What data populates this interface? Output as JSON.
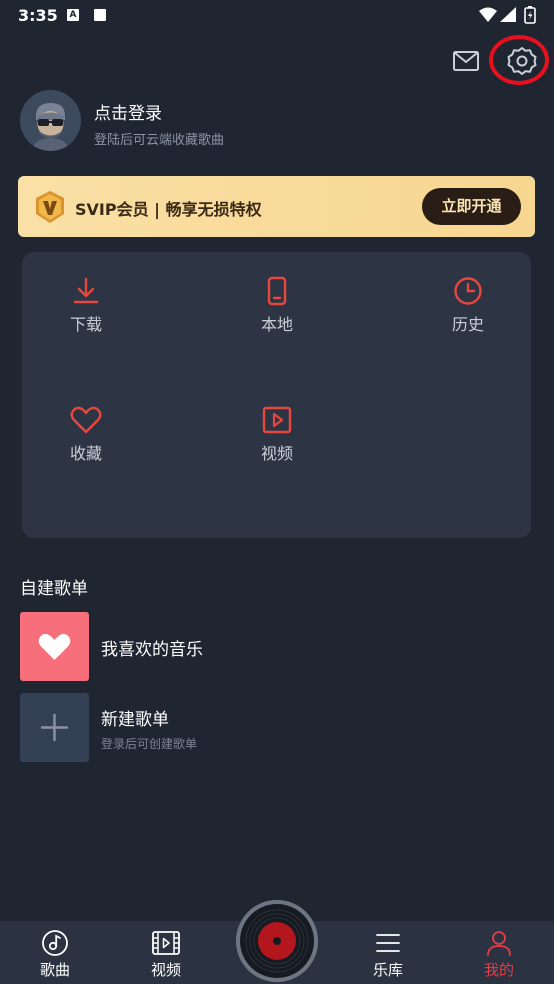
{
  "status_bar": {
    "time": "3:35",
    "indicator_letter": "A"
  },
  "header": {
    "mail_icon": "mail-icon",
    "settings_icon": "gear-icon"
  },
  "profile": {
    "title": "点击登录",
    "subtitle": "登陆后可云端收藏歌曲"
  },
  "svip": {
    "text": "SVIP会员 | 畅享无损特权",
    "button": "立即开通"
  },
  "grid": {
    "items": [
      {
        "label": "下载",
        "icon": "download-icon"
      },
      {
        "label": "本地",
        "icon": "phone-icon"
      },
      {
        "label": "历史",
        "icon": "clock-icon"
      },
      {
        "label": "收藏",
        "icon": "heart-icon"
      },
      {
        "label": "视频",
        "icon": "video-play-icon"
      }
    ]
  },
  "playlists": {
    "section_title": "自建歌单",
    "favorite": {
      "name": "我喜欢的音乐"
    },
    "create": {
      "name": "新建歌单",
      "subtitle": "登录后可创建歌单"
    }
  },
  "bottom_nav": {
    "items": [
      {
        "label": "歌曲",
        "icon": "music-note-icon"
      },
      {
        "label": "视频",
        "icon": "film-icon"
      },
      {
        "label": "乐库",
        "icon": "menu-icon"
      },
      {
        "label": "我的",
        "icon": "person-icon",
        "active": true
      }
    ],
    "disc_icon": "vinyl-disc-icon"
  },
  "colors": {
    "background": "#1f2632",
    "accent_red": "#e83a44",
    "highlight_ring": "#e8101e",
    "svip_gold": "#f7d690"
  }
}
